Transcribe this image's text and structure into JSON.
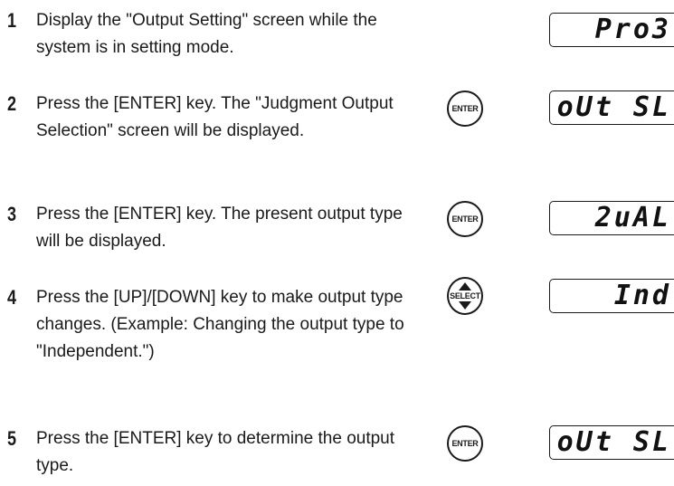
{
  "steps": [
    {
      "number": "1",
      "text": "Display the \"Output Setting\" screen while the system is in setting mode.",
      "button": "",
      "display": "Pro3"
    },
    {
      "number": "2",
      "text": "Press the [ENTER] key. The \"Judgment Output Selection\" screen will be displayed.",
      "button": "ENTER",
      "display": "oUt SL"
    },
    {
      "number": "3",
      "text": "Press the [ENTER] key. The present output type will be displayed.",
      "button": "ENTER",
      "display": "2uAL"
    },
    {
      "number": "4",
      "text": "Press the [UP]/[DOWN] key to make output type changes. (Example: Changing the output type to \"Independent.\")",
      "button": "SELECT",
      "display": "Ind"
    },
    {
      "number": "5",
      "text": "Press the [ENTER] key to determine the output type.",
      "button": "ENTER",
      "display": "oUt SL"
    }
  ]
}
